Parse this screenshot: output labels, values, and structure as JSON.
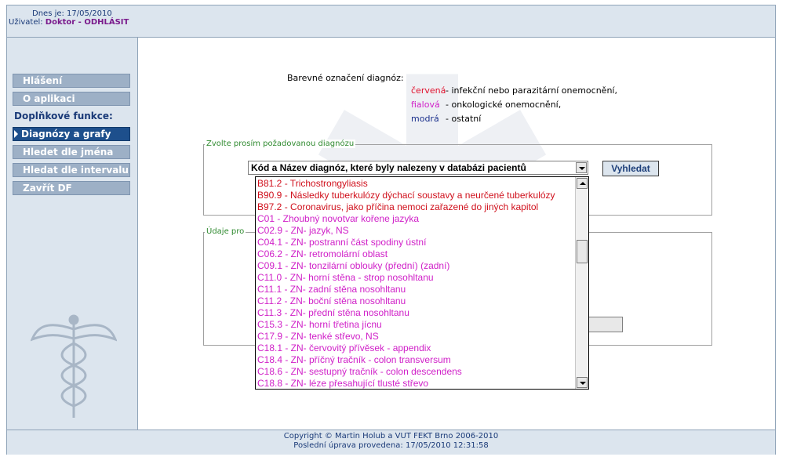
{
  "header": {
    "date_label": "Dnes je: 17/05/2010",
    "user_prefix": "Uživatel: ",
    "user_name": "Doktor - ODHLÁSIT"
  },
  "sidebar": {
    "items": [
      {
        "label": "Hlášení",
        "kind": "button"
      },
      {
        "label": "O aplikaci",
        "kind": "button"
      },
      {
        "label": "Doplňkové funkce:",
        "kind": "label"
      },
      {
        "label": "Diagnózy a grafy",
        "kind": "active"
      },
      {
        "label": "Hledet dle jména",
        "kind": "button"
      },
      {
        "label": "Hledat dle intervalu",
        "kind": "button"
      },
      {
        "label": "Zavřít DF",
        "kind": "button"
      }
    ]
  },
  "legend": {
    "title": "Barevné označení diagnóz:",
    "rows": [
      {
        "key": "červená",
        "text": "- infekční nebo parazitární onemocnění,",
        "color": "#e0102c"
      },
      {
        "key": "fialová",
        "text": "- onkologické onemocnění,",
        "color": "#d020c8"
      },
      {
        "key": "modrá",
        "text": "- ostatní",
        "color": "#1a2f8c"
      }
    ]
  },
  "diagnosis_box": {
    "legend": "Zvolte prosím požadovanou diagnózu",
    "select_value": "Kód a Název diagnóz, které byly nalezeny v databázi pacientů",
    "search_label": "Vyhledat"
  },
  "patient_box": {
    "legend": "Údaje pro"
  },
  "dropdown": {
    "options": [
      {
        "text": "B81.2 - Trichostrongyliasis",
        "color": "#d0101c"
      },
      {
        "text": "B90.9 - Následky tuberkulózy dýchací soustavy a neurčené tuberkulózy",
        "color": "#d0101c"
      },
      {
        "text": "B97.2 - Coronavirus, jako příčina nemoci zařazené do jiných kapitol",
        "color": "#d0101c"
      },
      {
        "text": "C01 - Zhoubný novotvar kořene jazyka",
        "color": "#d020c8"
      },
      {
        "text": "C02.9 - ZN- jazyk, NS",
        "color": "#d020c8"
      },
      {
        "text": "C04.1 - ZN- postranní část spodiny ústní",
        "color": "#d020c8"
      },
      {
        "text": "C06.2 - ZN- retromolární oblast",
        "color": "#d020c8"
      },
      {
        "text": "C09.1 - ZN- tonzilární oblouky (přední) (zadní)",
        "color": "#d020c8"
      },
      {
        "text": "C11.0 - ZN- horní stěna - strop nosohltanu",
        "color": "#d020c8"
      },
      {
        "text": "C11.1 - ZN- zadní stěna nosohltanu",
        "color": "#d020c8"
      },
      {
        "text": "C11.2 - ZN- boční stěna nosohltanu",
        "color": "#d020c8"
      },
      {
        "text": "C11.3 - ZN- přední stěna nosohltanu",
        "color": "#d020c8"
      },
      {
        "text": "C15.3 - ZN- horní třetina jícnu",
        "color": "#d020c8"
      },
      {
        "text": "C17.9 - ZN- tenké střevo, NS",
        "color": "#d020c8"
      },
      {
        "text": "C18.1 - ZN- červovitý přívěsek - appendix",
        "color": "#d020c8"
      },
      {
        "text": "C18.4 - ZN- příčný tračník - colon transversum",
        "color": "#d020c8"
      },
      {
        "text": "C18.6 - ZN- sestupný tračník - colon descendens",
        "color": "#d020c8"
      },
      {
        "text": "C18.8 - ZN- léze přesahující tlusté střevo",
        "color": "#d020c8"
      }
    ]
  },
  "footer": {
    "line1": "Copyright © Martin Holub a VUT FEKT Brno 2006-2010",
    "line2": "Poslední úprava provedena: 17/05/2010 12:31:58"
  },
  "icons": [
    "caduceus-icon",
    "star-of-life-watermark-icon",
    "dropdown-arrow-icon",
    "scroll-up-icon",
    "scroll-down-icon"
  ]
}
